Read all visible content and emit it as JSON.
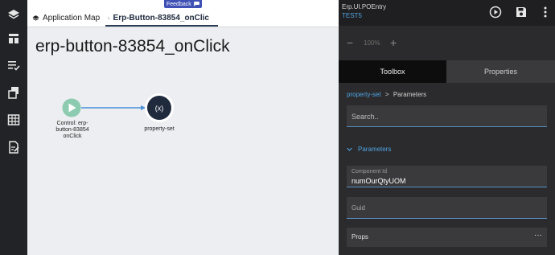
{
  "sidebar": {
    "items": [
      {
        "icon": "layers-icon"
      },
      {
        "icon": "dashboard-icon"
      },
      {
        "icon": "checklist-icon"
      },
      {
        "icon": "documents-icon"
      },
      {
        "icon": "table-icon"
      },
      {
        "icon": "edit-document-icon"
      }
    ]
  },
  "tabs": {
    "app_map": "Application Map",
    "flow": "Erp-Button-83854_onClic"
  },
  "feedback": "Feedback",
  "canvas": {
    "title": "erp-button-83854_onClick",
    "start_node": {
      "label_lines": [
        "Control: erp-",
        "button-83854",
        "onClick"
      ]
    },
    "action_node": {
      "symbol": "(x)",
      "label": "property-set"
    },
    "colors": {
      "start": "#8ccbb0",
      "connector": "#4a90d9",
      "action_ring": "#1f2a3d"
    }
  },
  "panel": {
    "app_name": "Erp.UI.POEntry",
    "environment": "TEST5",
    "zoom": {
      "minus": "−",
      "value": "100%",
      "plus": "+"
    },
    "tabs": {
      "toolbox": "Toolbox",
      "properties": "Properties"
    },
    "breadcrumb": {
      "link": "property-set",
      "separator": ">",
      "current": "Parameters"
    },
    "search_placeholder": "Search..",
    "section_title": "Parameters",
    "component_id": {
      "label": "Component Id",
      "value": "numOurQtyUOM"
    },
    "guid_label": "Guid",
    "props_label": "Props",
    "props_menu": "···"
  }
}
